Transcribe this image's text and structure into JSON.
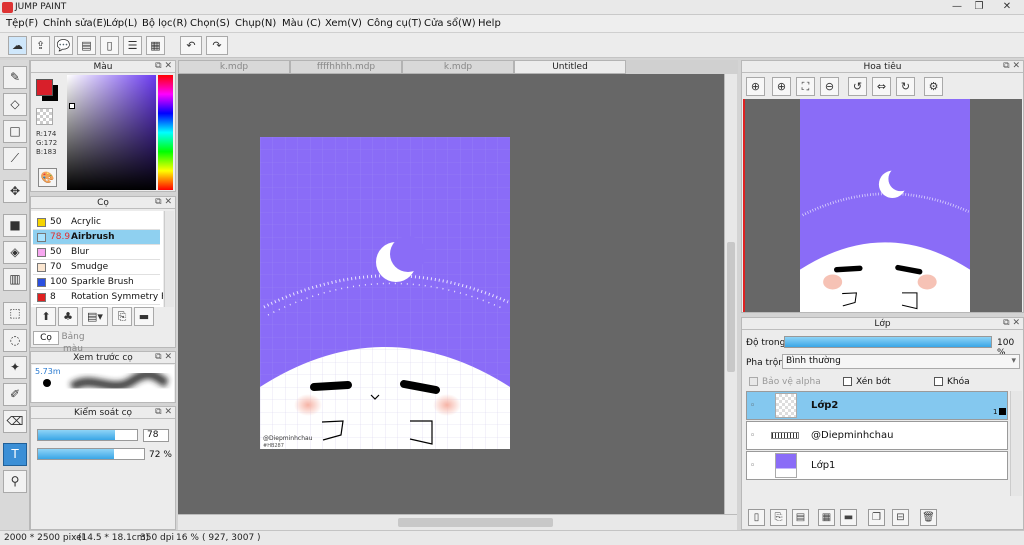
{
  "app": {
    "title": "JUMP PAINT"
  },
  "menu": [
    {
      "label": "Tệp(F)"
    },
    {
      "label": "Chỉnh sửa(E)"
    },
    {
      "label": "Lớp(L)"
    },
    {
      "label": "Bộ lọc(R)"
    },
    {
      "label": "Chọn(S)"
    },
    {
      "label": "Chụp(N)"
    },
    {
      "label": "Màu (C)"
    },
    {
      "label": "Xem(V)"
    },
    {
      "label": "Công cụ(T)"
    },
    {
      "label": "Cửa sổ(W)"
    },
    {
      "label": "Help"
    }
  ],
  "color_panel": {
    "title": "Màu",
    "r": "R:174",
    "g": "G:172",
    "b": "B:183",
    "fg_color": "#d81f2a",
    "bg_color": "#000000"
  },
  "brush_panel": {
    "title": "Cọ",
    "brushes": [
      {
        "value": "50",
        "name": "Acrylic",
        "color": "#f6d400",
        "selected": false
      },
      {
        "value": "78.9",
        "name": "Airbrush",
        "color": "#a9e3ff",
        "selected": true
      },
      {
        "value": "50",
        "name": "Blur",
        "color": "#f7a7f0",
        "selected": false
      },
      {
        "value": "70",
        "name": "Smudge",
        "color": "#fbe6d0",
        "selected": false
      },
      {
        "value": "100",
        "name": "Sparkle Brush",
        "color": "#2a4fe0",
        "selected": false
      },
      {
        "value": "8",
        "name": "Rotation Symmetry Pe",
        "color": "#e02020",
        "selected": false
      }
    ],
    "tab_brush": "Cọ",
    "tab_palette": "Bảng màu"
  },
  "preview_panel": {
    "title": "Xem trước cọ",
    "size": "5.73m"
  },
  "control_panel": {
    "title": "Kiểm soát cọ",
    "size_value": "78",
    "size_fill": 0.78,
    "opacity_value": "72 %",
    "opacity_fill": 0.72
  },
  "tabs": [
    {
      "label": "k.mdp",
      "active": false
    },
    {
      "label": "ffffhhhh.mdp",
      "active": false
    },
    {
      "label": "k.mdp",
      "active": false
    },
    {
      "label": "Untitled",
      "active": true
    }
  ],
  "canvas": {
    "signature": "@Diepminhchau",
    "signature_sub": "#HB287"
  },
  "navigator": {
    "title": "Hoa tiêu"
  },
  "layers_panel": {
    "title": "Lớp",
    "opacity_label": "Độ trong",
    "opacity_value": "100 %",
    "opacity_fill": 1.0,
    "blend_label": "Pha trộn",
    "blend_value": "Bình thường",
    "alpha_protect": "Bảo vệ alpha",
    "clipping": "Xén bớt",
    "lock": "Khóa",
    "layers": [
      {
        "name": "Lớp2",
        "selected": true,
        "badge": "1"
      },
      {
        "name": "@Diepminhchau",
        "selected": false,
        "badge": ""
      },
      {
        "name": "Lớp1",
        "selected": false,
        "badge": ""
      }
    ]
  },
  "status": {
    "size": "2000 * 2500 pixel",
    "cm": "(14.5 * 18.1cm)",
    "dpi": "350 dpi",
    "zoom": "16 %",
    "coords": "( 927, 3007 )"
  },
  "colors": {
    "canvas_purple": "#8a6cf7",
    "selection_blue": "#84c8ef",
    "workspace": "#676767"
  }
}
